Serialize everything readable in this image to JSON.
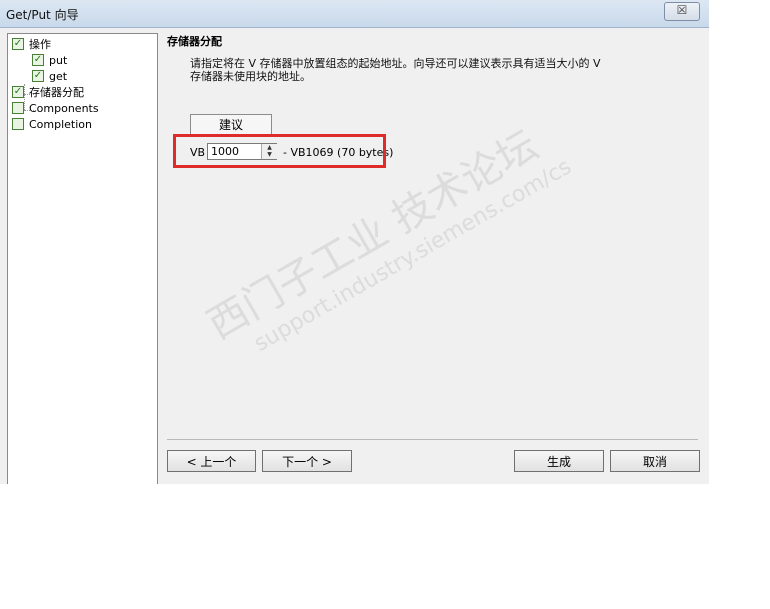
{
  "window": {
    "title": "Get/Put 向导",
    "close_label": "☒"
  },
  "tree": {
    "items": [
      {
        "label": "操作",
        "checked": true,
        "level": 0
      },
      {
        "label": "put",
        "checked": true,
        "level": 1
      },
      {
        "label": "get",
        "checked": true,
        "level": 1
      },
      {
        "label": "存储器分配",
        "checked": true,
        "level": 0
      },
      {
        "label": "Components",
        "checked": false,
        "level": 0
      },
      {
        "label": "Completion",
        "checked": false,
        "level": 0
      }
    ]
  },
  "main": {
    "section_title": "存储器分配",
    "description_line1": "请指定将在 V 存储器中放置组态的起始地址。向导还可以建议表示具有适当大小的 V",
    "description_line2": "存储器未使用块的地址。",
    "suggest_label": "建议",
    "address_prefix": "VB",
    "address_value": "1000",
    "address_range": "- VB1069 (70 bytes)"
  },
  "buttons": {
    "prev": "< 上一个",
    "next": "下一个 >",
    "generate": "生成",
    "cancel": "取消"
  },
  "watermark": {
    "line1": "西门子工业 技术论坛",
    "line2": "support.industry.siemens.com/cs"
  },
  "colors": {
    "highlight": "#e02b2b",
    "check_green": "#1d7a1d"
  }
}
